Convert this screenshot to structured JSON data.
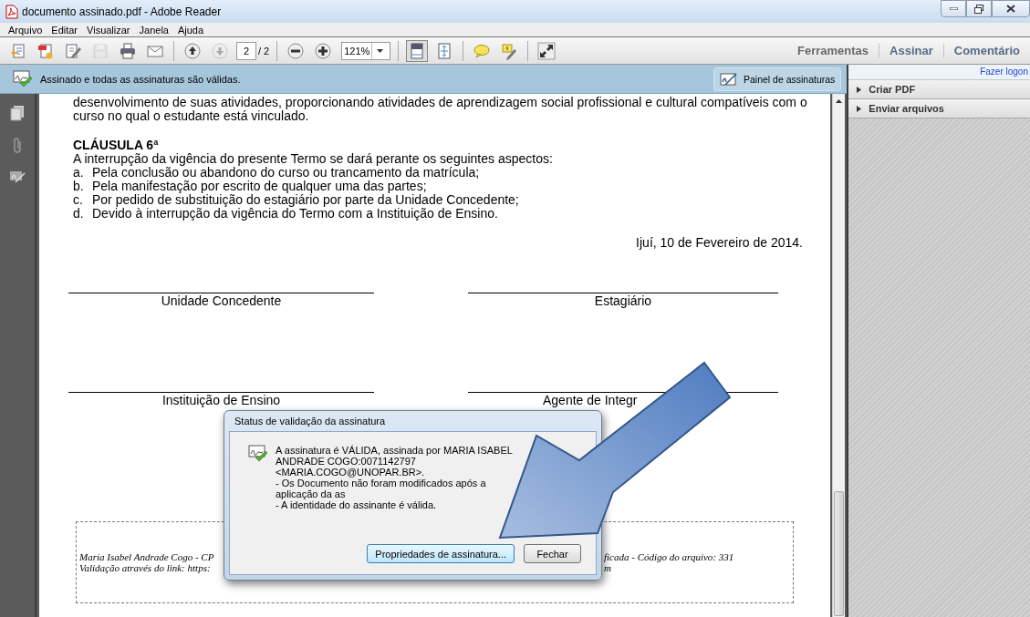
{
  "window": {
    "title": "documento assinado.pdf - Adobe Reader"
  },
  "menu": [
    "Arquivo",
    "Editar",
    "Visualizar",
    "Janela",
    "Ajuda"
  ],
  "toolbar": {
    "file_buttons": [
      {
        "kind": "open",
        "disabled": false
      },
      {
        "kind": "create",
        "disabled": false
      },
      {
        "kind": "edit",
        "disabled": false
      },
      {
        "kind": "save",
        "disabled": true
      },
      {
        "kind": "print",
        "disabled": false
      },
      {
        "kind": "email",
        "disabled": false
      }
    ],
    "nav_buttons": [
      {
        "kind": "up",
        "disabled": false
      },
      {
        "kind": "down",
        "disabled": true
      }
    ],
    "page": "2",
    "page_count": "/ 2",
    "zoom_buttons": [
      {
        "kind": "minus",
        "disabled": false
      },
      {
        "kind": "plus",
        "disabled": false
      }
    ],
    "zoom": "121%",
    "view_buttons": [
      {
        "kind": "fit-page",
        "selected": true
      },
      {
        "kind": "fit-width",
        "selected": false
      }
    ],
    "comment_buttons": [
      {
        "kind": "comment",
        "disabled": false
      },
      {
        "kind": "highlight",
        "disabled": false
      }
    ],
    "expand_buttons": [
      {
        "kind": "expand",
        "disabled": false
      }
    ],
    "tabs": [
      "Ferramentas",
      "Assinar",
      "Comentário"
    ]
  },
  "signature_bar": {
    "message": "Assinado e todas as assinaturas são válidas.",
    "button": "Painel de assinaturas"
  },
  "right_panel": {
    "login_link": "Fazer logon",
    "sections": [
      {
        "label": "Criar PDF",
        "expanded": false
      },
      {
        "label": "Enviar arquivos",
        "expanded": false
      }
    ]
  },
  "document": {
    "paragraph_lines": [
      "desenvolvimento de suas atividades, proporcionando atividades de aprendizagem social profissional e cultural compatíveis com o",
      "curso no qual o estudante está vinculado."
    ],
    "heading": "CLÁUSULA 6ª",
    "intro": "A interrupção da vigência do presente Termo se dará perante os seguintes aspectos:",
    "items": [
      {
        "marker": "a.",
        "text": "Pela conclusão ou abandono do curso ou trancamento da matrícula;"
      },
      {
        "marker": "b.",
        "text": "Pela manifestação por escrito de qualquer uma das partes;"
      },
      {
        "marker": "c.",
        "text": "Por pedido de substituição do estagiário por parte da Unidade Concedente;"
      },
      {
        "marker": "d.",
        "text": "Devido à interrupção da vigência do Termo com a Instituição de Ensino."
      }
    ],
    "date": "Ijuí, 10 de Fevereiro de 2014.",
    "signatures": [
      [
        "Unidade Concedente",
        "Estagiário"
      ],
      [
        "Instituição de Ensino",
        "Agente de Integr"
      ]
    ],
    "footer_lines": [
      [
        "Maria Isabel Andrade Cogo - CP",
        "ficada - Código do arquivo: 331"
      ],
      [
        "Validação através do link: https:",
        "m"
      ]
    ]
  },
  "dialog": {
    "title": "Status de validação da assinatura",
    "lines": [
      "A assinatura é VÁLIDA, assinada por MARIA ISABEL ANDRADE COGO:0071142797 <MARIA.COGO@UNOPAR.BR>.",
      "- Os Documento não foram modificados após a aplicação da as",
      "- A identidade do assinante é válida."
    ],
    "buttons": [
      "Propriedades de assinatura...",
      "Fechar"
    ]
  }
}
